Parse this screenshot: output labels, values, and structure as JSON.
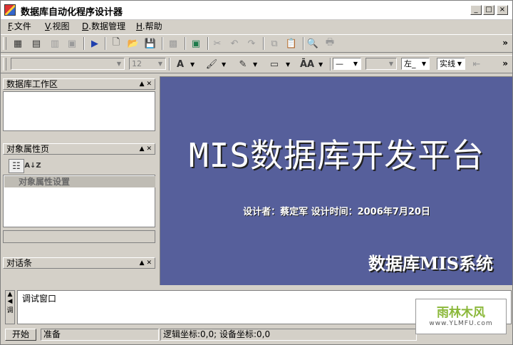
{
  "window": {
    "title": "数据库自动化程序设计器",
    "controls": [
      "_",
      "□",
      "×"
    ]
  },
  "menu": [
    {
      "key": "F",
      "label": ".文件"
    },
    {
      "key": "V",
      "label": ".视图"
    },
    {
      "key": "D",
      "label": ".数据管理"
    },
    {
      "key": "H",
      "label": ".帮助"
    }
  ],
  "toolbar2": {
    "font_size": "12",
    "align_value": "左_",
    "line_style_value": "实线",
    "overflow": "»"
  },
  "panes": {
    "workspace_title": "数据库工作区",
    "properties_title": "对象属性页",
    "properties_section": "对象属性设置",
    "dialog_title": "对话条"
  },
  "main": {
    "headline": "MIS数据库开发平台",
    "subline": "设计者：蔡定军  设计时间：2006年7月20日",
    "brand": "数据库MIS系统"
  },
  "console": {
    "tab_label": "调",
    "text": "调试窗口"
  },
  "status": {
    "start_label": "开始",
    "ready": "准备",
    "coords": "逻辑坐标:0,0; 设备坐标:0,0"
  },
  "watermark": {
    "name": "雨林木风",
    "url": "www.YLMFU.com"
  }
}
